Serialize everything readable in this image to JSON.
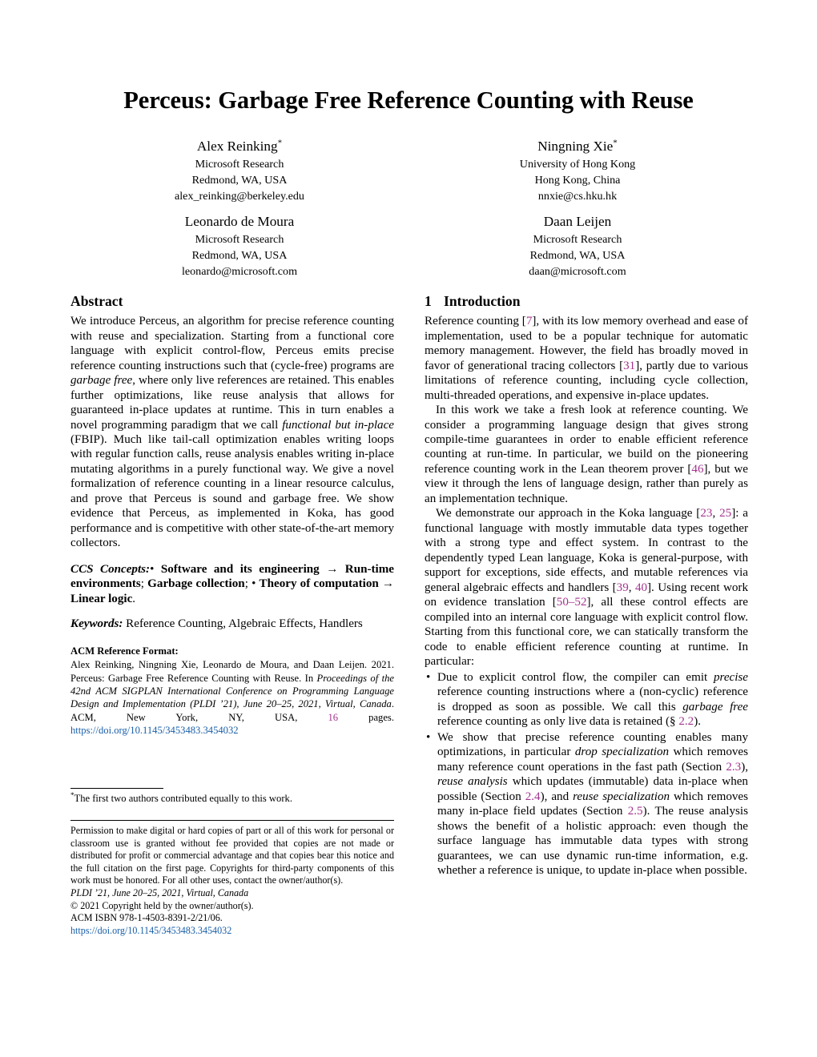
{
  "paper": {
    "title": "Perceus: Garbage Free Reference Counting with Reuse",
    "authors": [
      {
        "name": "Alex Reinking",
        "star": "*",
        "affiliation": "Microsoft Research",
        "location": "Redmond, WA, USA",
        "email": "alex_reinking@berkeley.edu"
      },
      {
        "name": "Ningning Xie",
        "star": "*",
        "affiliation": "University of Hong Kong",
        "location": "Hong Kong, China",
        "email": "nnxie@cs.hku.hk"
      },
      {
        "name": "Leonardo de Moura",
        "star": "",
        "affiliation": "Microsoft Research",
        "location": "Redmond, WA, USA",
        "email": "leonardo@microsoft.com"
      },
      {
        "name": "Daan Leijen",
        "star": "",
        "affiliation": "Microsoft Research",
        "location": "Redmond, WA, USA",
        "email": "daan@microsoft.com"
      }
    ]
  },
  "abstract": {
    "heading": "Abstract",
    "p1_a": "We introduce Perceus, an algorithm for precise reference counting with reuse and specialization. Starting from a functional core language with explicit control-flow, Perceus emits precise reference counting instructions such that (cycle-free) programs are ",
    "p1_em1": "garbage free",
    "p1_b": ", where only live references are retained. This enables further optimizations, like reuse analysis that allows for guaranteed in-place updates at runtime. This in turn enables a novel programming paradigm that we call ",
    "p1_em2": "functional but in-place",
    "p1_c": " (FBIP). Much like tail-call optimization enables writing loops with regular function calls, reuse analysis enables writing in-place mutating algorithms in a purely functional way. We give a novel formalization of reference counting in a linear resource calculus, and prove that Perceus is sound and garbage free. We show evidence that Perceus, as implemented in Koka, has good performance and is competitive with other state-of-the-art memory collectors."
  },
  "ccs": {
    "lead": "CCS Concepts:",
    "bullet1": "• ",
    "t1": "Software and its engineering",
    "arrow1": " → ",
    "t2": "Run-time environments",
    "sep1": "; ",
    "t3": "Garbage collection",
    "sep2": "; ",
    "bullet2": "• ",
    "t4": "Theory of computation",
    "arrow2": " → ",
    "t5": "Linear logic",
    "end": "."
  },
  "keywords": {
    "lead": "Keywords:",
    "value": " Reference Counting, Algebraic Effects, Handlers"
  },
  "acm_reference": {
    "heading": "ACM Reference Format:",
    "line_a": "Alex Reinking, Ningning Xie, Leonardo de Moura, and Daan Leijen. 2021. Perceus: Garbage Free Reference Counting with Reuse. In ",
    "italic": "Proceedings of the 42nd ACM SIGPLAN International Conference on Programming Language Design and Implementation (PLDI ’21), June 20–25, 2021, Virtual, Canada",
    "line_b": ". ACM, New York, NY, USA, ",
    "pages": "16",
    "line_c": " pages.",
    "doi": "https://doi.org/10.1145/3453483.3454032"
  },
  "footnote": {
    "star": "*",
    "text": "The first two authors contributed equally to this work."
  },
  "permission": {
    "body": "Permission to make digital or hard copies of part or all of this work for personal or classroom use is granted without fee provided that copies are not made or distributed for profit or commercial advantage and that copies bear this notice and the full citation on the first page. Copyrights for third-party components of this work must be honored. For all other uses, contact the owner/author(s).",
    "venue": "PLDI ’21, June 20–25, 2021, Virtual, Canada",
    "copyright": "© 2021 Copyright held by the owner/author(s).",
    "isbn": "ACM ISBN 978-1-4503-8391-2/21/06.",
    "doi": "https://doi.org/10.1145/3453483.3454032"
  },
  "introduction": {
    "number": "1",
    "heading": "Introduction",
    "p1_a": "Reference counting [",
    "p1_c1": "7",
    "p1_b": "], with its low memory overhead and ease of implementation, used to be a popular technique for automatic memory management. However, the field has broadly moved in favor of generational tracing collectors [",
    "p1_c2": "31",
    "p1_c": "], partly due to various limitations of reference counting, including cycle collection, multi-threaded operations, and expensive in-place updates.",
    "p2_a": "In this work we take a fresh look at reference counting. We consider a programming language design that gives strong compile-time guarantees in order to enable efficient reference counting at run-time. In particular, we build on the pioneering reference counting work in the Lean theorem prover [",
    "p2_c1": "46",
    "p2_b": "], but we view it through the lens of language design, rather than purely as an implementation technique.",
    "p3_a": "We demonstrate our approach in the Koka language [",
    "p3_c1": "23",
    "p3_c2": "25",
    "p3_b": ", ",
    "p3_c": "]: a functional language with mostly immutable data types together with a strong type and effect system. In contrast to the dependently typed Lean language, Koka is general-purpose, with support for exceptions, side effects, and mutable references via general algebraic effects and handlers [",
    "p3_c3": "39",
    "p3_d": ", ",
    "p3_c4": "40",
    "p3_e": "]. Using recent work on evidence translation [",
    "p3_c5": "50–52",
    "p3_f": "], all these control effects are compiled into an internal core language with explicit control flow. Starting from this functional core, we can statically transform the code to enable efficient reference counting at runtime. In particular:"
  },
  "bullets": [
    {
      "a": "Due to explicit control flow, the compiler can emit ",
      "em1": "precise",
      "b": " reference counting instructions where a (non-cyclic) reference is dropped as soon as possible. We call this ",
      "em2": "garbage free",
      "c": " reference counting as only live data is retained (§ ",
      "ref": "2.2",
      "d": ")."
    },
    {
      "a": "We show that precise reference counting enables many optimizations, in particular ",
      "em1": "drop specialization",
      "b": " which removes many reference count operations in the fast path (Section ",
      "ref1": "2.3",
      "c": "), ",
      "em2": "reuse analysis",
      "d": " which updates (immutable) data in-place when possible (Section ",
      "ref2": "2.4",
      "e": "), and ",
      "em3": "reuse specialization",
      "f": " which removes many in-place field updates (Section ",
      "ref3": "2.5",
      "g": "). The reuse analysis shows the benefit of a holistic approach: even though the surface language has immutable data types with strong guarantees, we can use dynamic run-time information, e.g. whether a reference is unique, to update in-place when possible."
    }
  ],
  "colors": {
    "citation": "#a3348e",
    "link": "#1a5fa8",
    "text": "#000000",
    "background": "#ffffff"
  }
}
